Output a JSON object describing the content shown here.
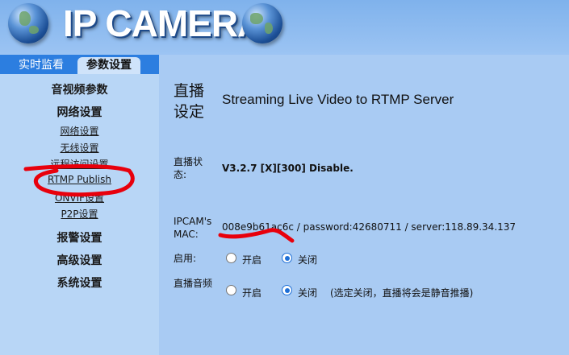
{
  "header": {
    "title": "IP CAMERA"
  },
  "tabs": {
    "live": "实时监看",
    "params": "参数设置"
  },
  "sidebar": {
    "av_params": "音视频参数",
    "network": "网络设置",
    "network_items": [
      "网络设置",
      "无线设置",
      "远程访问设置",
      "RTMP Publish",
      "ONVIF设置",
      "P2P设置"
    ],
    "alarm": "报警设置",
    "advanced": "高级设置",
    "system": "系统设置"
  },
  "main": {
    "heading": "直播设定",
    "subtitle": "Streaming Live Video to RTMP Server",
    "status_label": "直播状态:",
    "status_value": "V3.2.7 [X][300] Disable.",
    "mac_label": "IPCAM's MAC:",
    "mac_value": "008e9b61ac6c / password:42680711 / server:118.89.34.137",
    "enable_label": "启用:",
    "enable_on": "开启",
    "enable_off": "关闭",
    "enable_selected": "关闭",
    "audio_label": "直播音频",
    "audio_on": "开启",
    "audio_off": "关闭",
    "audio_selected": "关闭",
    "audio_note": "(选定关闭，直播将会是静音推播)"
  },
  "colors": {
    "header": "#8dbcf0",
    "sidebar": "#b8d6f6",
    "tabbar": "#2c7ee0",
    "main": "#a9cbf3",
    "annotation": "#e8000c",
    "radio_selected": "#1e6fd6"
  }
}
